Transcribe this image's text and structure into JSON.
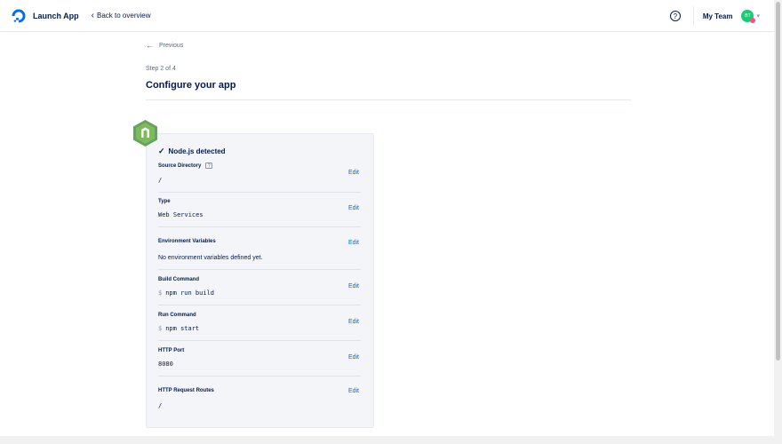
{
  "header": {
    "app_title": "Launch App",
    "back_label": "Back to overview",
    "help_glyph": "?",
    "team_label": "My Team",
    "avatar_initials": "BT"
  },
  "nav": {
    "previous_label": "Previous"
  },
  "page": {
    "step_label": "Step 2 of 4",
    "title": "Configure your app"
  },
  "card": {
    "detected_label": "Node.js detected",
    "edit_label": "Edit",
    "rows": [
      {
        "label": "Source Directory",
        "value": "/"
      },
      {
        "label": "Type",
        "value": "Web Services"
      },
      {
        "label": "Environment Variables",
        "value": "No environment variables defined yet."
      },
      {
        "label": "Build Command",
        "prompt": "$",
        "value": "npm run build"
      },
      {
        "label": "Run Command",
        "prompt": "$",
        "value": "npm start"
      },
      {
        "label": "HTTP Port",
        "value": "8080"
      },
      {
        "label": "HTTP Request Routes",
        "value": "/"
      }
    ]
  },
  "colors": {
    "brand_blue": "#0069ff",
    "text_dark": "#031b4e",
    "node_green": "#68a063"
  }
}
